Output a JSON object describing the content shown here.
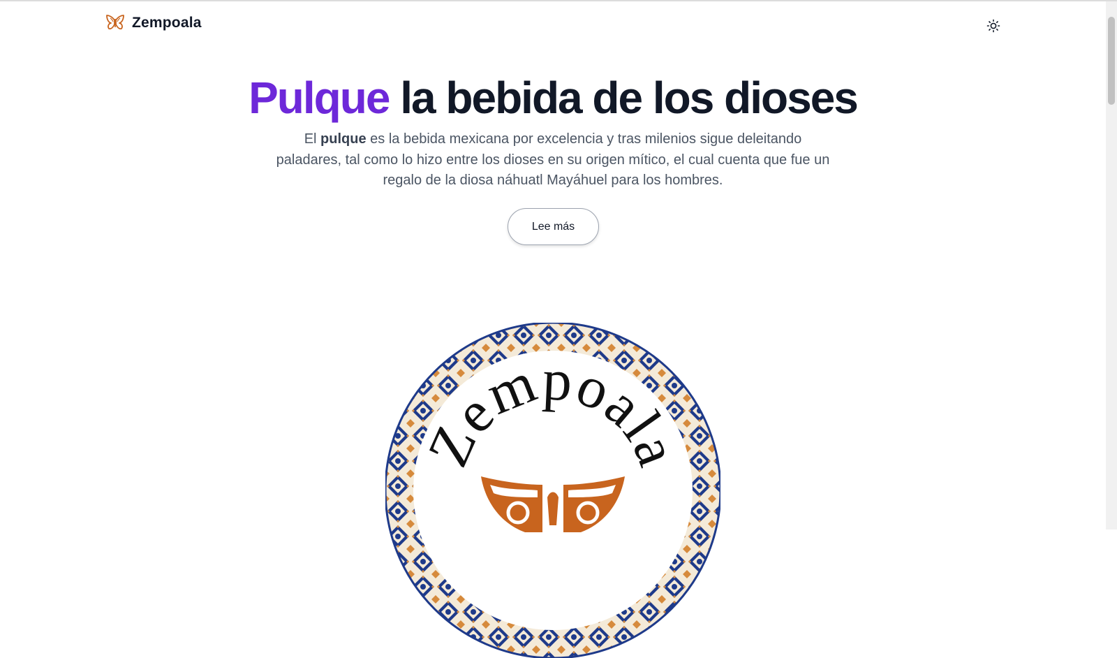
{
  "header": {
    "brand_name": "Zempoala",
    "logo_icon": "butterfly-icon",
    "theme_icon": "sun-icon"
  },
  "hero": {
    "title_accent": "Pulque",
    "title_rest": "la bebida de los dioses",
    "desc_prefix": "El ",
    "desc_bold": "pulque",
    "desc_rest": " es la bebida mexicana por excelencia y tras milenios sigue deleitando paladares, tal como lo hizo entre los dioses en su origen mítico, el cual cuenta que fue un regalo de la diosa náhuatl Mayáhuel para los hombres.",
    "cta_label": "Lee más"
  },
  "emblem": {
    "text": "Zempoala"
  },
  "colors": {
    "accent": "#6d28d9",
    "text_dark": "#111827",
    "text_body": "#4b5563",
    "logo_orange": "#c8641e",
    "tile_blue": "#1e3a8a"
  }
}
